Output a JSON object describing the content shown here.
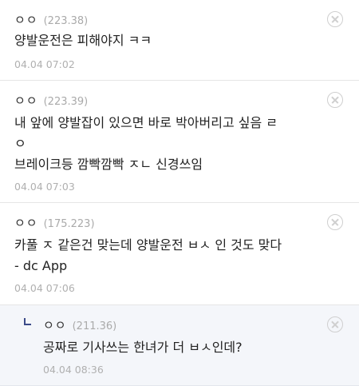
{
  "comments": [
    {
      "nick": "ㅇㅇ",
      "ip": "(223.38)",
      "lines": [
        "양발운전은 피해야지 ㅋㅋ"
      ],
      "date": "04.04 07:02"
    },
    {
      "nick": "ㅇㅇ",
      "ip": "(223.39)",
      "lines": [
        "내 앞에 양발잡이 있으면 바로 박아버리고 싶음 ㄹ",
        "ㅇ",
        "브레이크등 깜빡깜빡 ㅈㄴ 신경쓰임"
      ],
      "date": "04.04 07:03"
    },
    {
      "nick": "ㅇㅇ",
      "ip": "(175.223)",
      "lines": [
        "카풀 ㅈ 같은건 맞는데 양발운전 ㅂㅅ 인 것도 맞다",
        "- dc App"
      ],
      "date": "04.04 07:06"
    }
  ],
  "reply": {
    "nick": "ㅇㅇ",
    "ip": "(211.36)",
    "lines": [
      "공짜로 기사쓰는 한녀가 더 ㅂㅅ인데?"
    ],
    "date": "04.04 08:36"
  }
}
